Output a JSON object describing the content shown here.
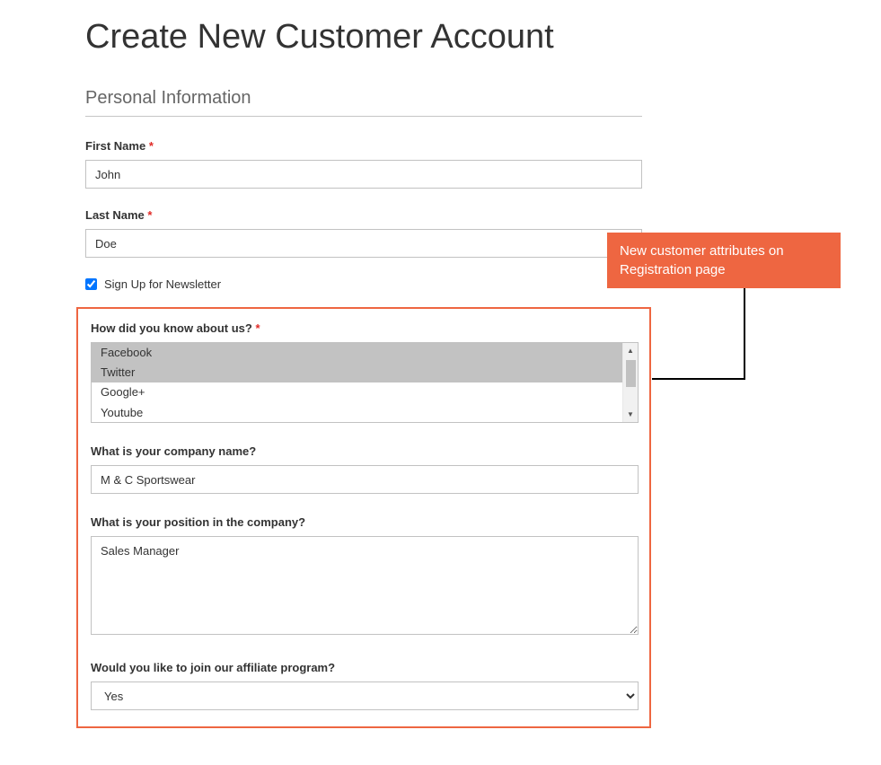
{
  "page": {
    "title": "Create New Customer Account"
  },
  "section": {
    "title": "Personal Information"
  },
  "fields": {
    "first_name": {
      "label": "First Name",
      "value": "John"
    },
    "last_name": {
      "label": "Last Name",
      "value": "Doe"
    },
    "newsletter": {
      "label": "Sign Up for Newsletter",
      "checked": true
    },
    "source": {
      "label": "How did you know about us?",
      "options": [
        "Facebook",
        "Twitter",
        "Google+",
        "Youtube"
      ],
      "selected": [
        "Facebook",
        "Twitter"
      ]
    },
    "company": {
      "label": "What is your company name?",
      "value": "M & C Sportswear"
    },
    "position": {
      "label": "What is your position in the company?",
      "value": "Sales Manager"
    },
    "affiliate": {
      "label": "Would you like to join our affiliate program?",
      "value": "Yes"
    }
  },
  "callout": {
    "text": "New customer attributes on Registration page"
  }
}
